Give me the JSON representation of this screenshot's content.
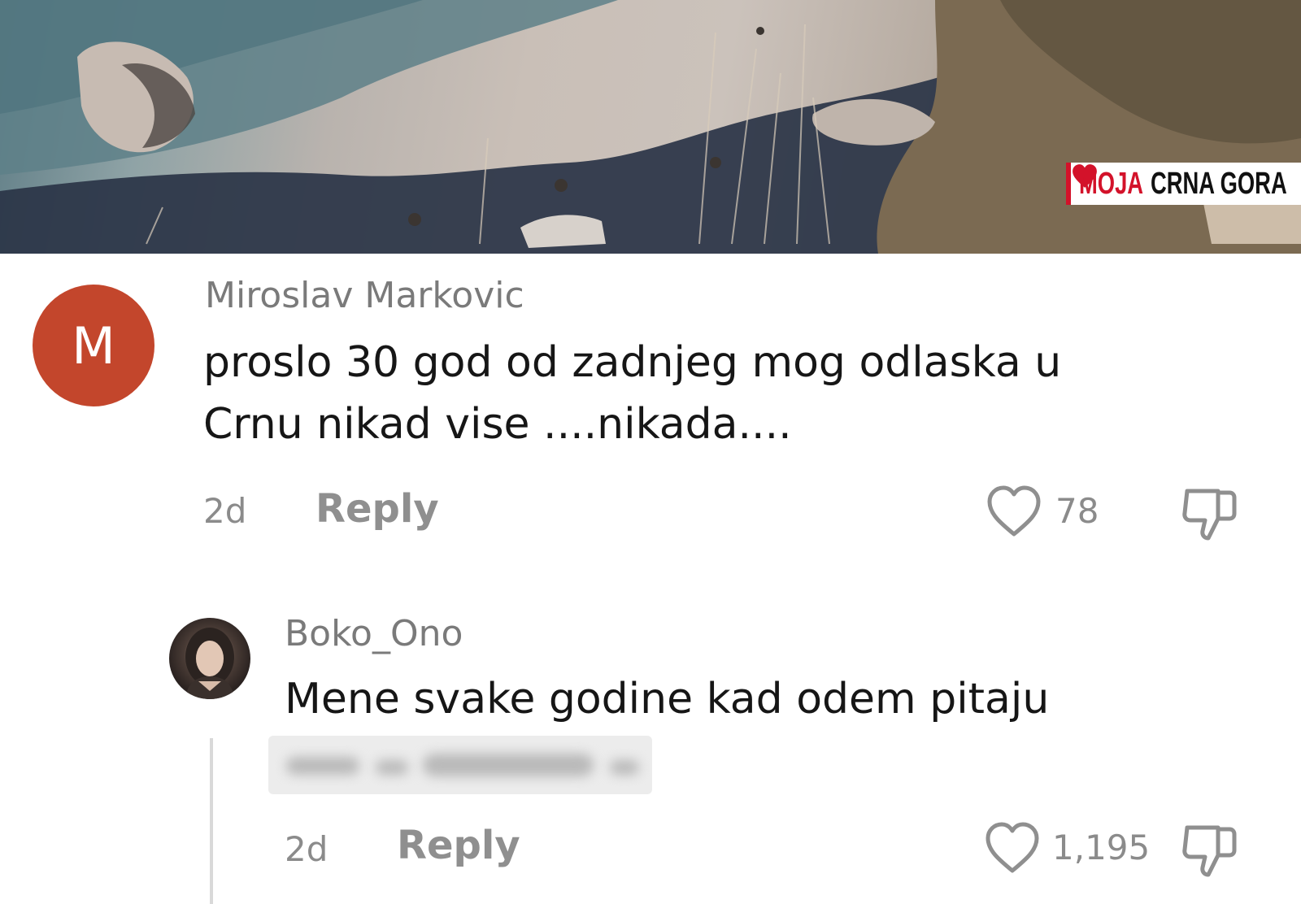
{
  "banner": {
    "logo": {
      "word1": "MOJA",
      "word2": "CRNA GORA",
      "brand_red": "#d3122a",
      "brand_dark": "#111111"
    }
  },
  "comments": [
    {
      "avatar_letter": "M",
      "avatar_color": "#c3462c",
      "author": "Miroslav Markovic",
      "text_lines": [
        "proslo 30 god od zadnjeg mog odlaska u",
        "Crnu nikad vise ....nikada...."
      ],
      "time": "2d",
      "reply_label": "Reply",
      "likes": "78",
      "like_icon": "heart-outline-icon",
      "dislike_icon": "thumbs-down-icon"
    },
    {
      "avatar_icon": "profile-photo",
      "author": "Boko_Ono",
      "text_lines": [
        "Mene svake godine kad odem pitaju"
      ],
      "time": "2d",
      "reply_label": "Reply",
      "likes": "1,195",
      "like_icon": "heart-outline-icon",
      "dislike_icon": "thumbs-down-icon"
    }
  ]
}
